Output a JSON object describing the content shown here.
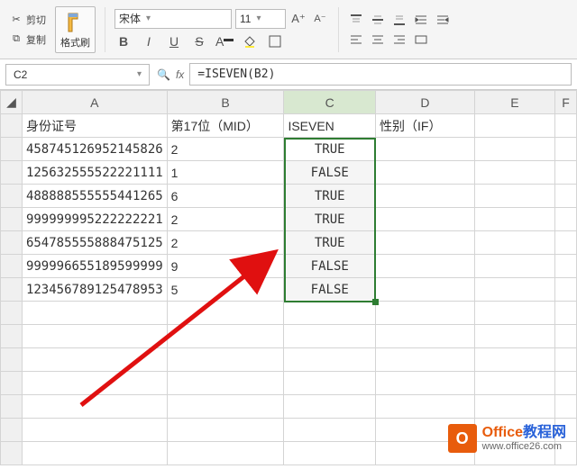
{
  "ribbon": {
    "cut": "剪切",
    "copy": "复制",
    "format_painter": "格式刷",
    "font_name": "宋体",
    "font_size": "11",
    "bold": "B",
    "italic": "I",
    "underline": "U",
    "strike": "S"
  },
  "namebox": "C2",
  "formula": "=ISEVEN(B2)",
  "columns": [
    "A",
    "B",
    "C",
    "D",
    "E",
    "F"
  ],
  "headers": {
    "a": "身份证号",
    "b": "第17位（MID）",
    "c": "ISEVEN",
    "d": "性别（IF）"
  },
  "rows": [
    {
      "a": "458745126952145826",
      "b": "2",
      "c": "TRUE"
    },
    {
      "a": "125632555522221111",
      "b": "1",
      "c": "FALSE"
    },
    {
      "a": "488888555555441265",
      "b": "6",
      "c": "TRUE"
    },
    {
      "a": "999999995222222221",
      "b": "2",
      "c": "TRUE"
    },
    {
      "a": "654785555888475125",
      "b": "2",
      "c": "TRUE"
    },
    {
      "a": "999996655189599999",
      "b": "9",
      "c": "FALSE"
    },
    {
      "a": "123456789125478953",
      "b": "5",
      "c": "FALSE"
    }
  ],
  "watermark": {
    "logo": "O",
    "brand_a": "Office",
    "brand_b": "教程网",
    "url": "www.office26.com"
  }
}
